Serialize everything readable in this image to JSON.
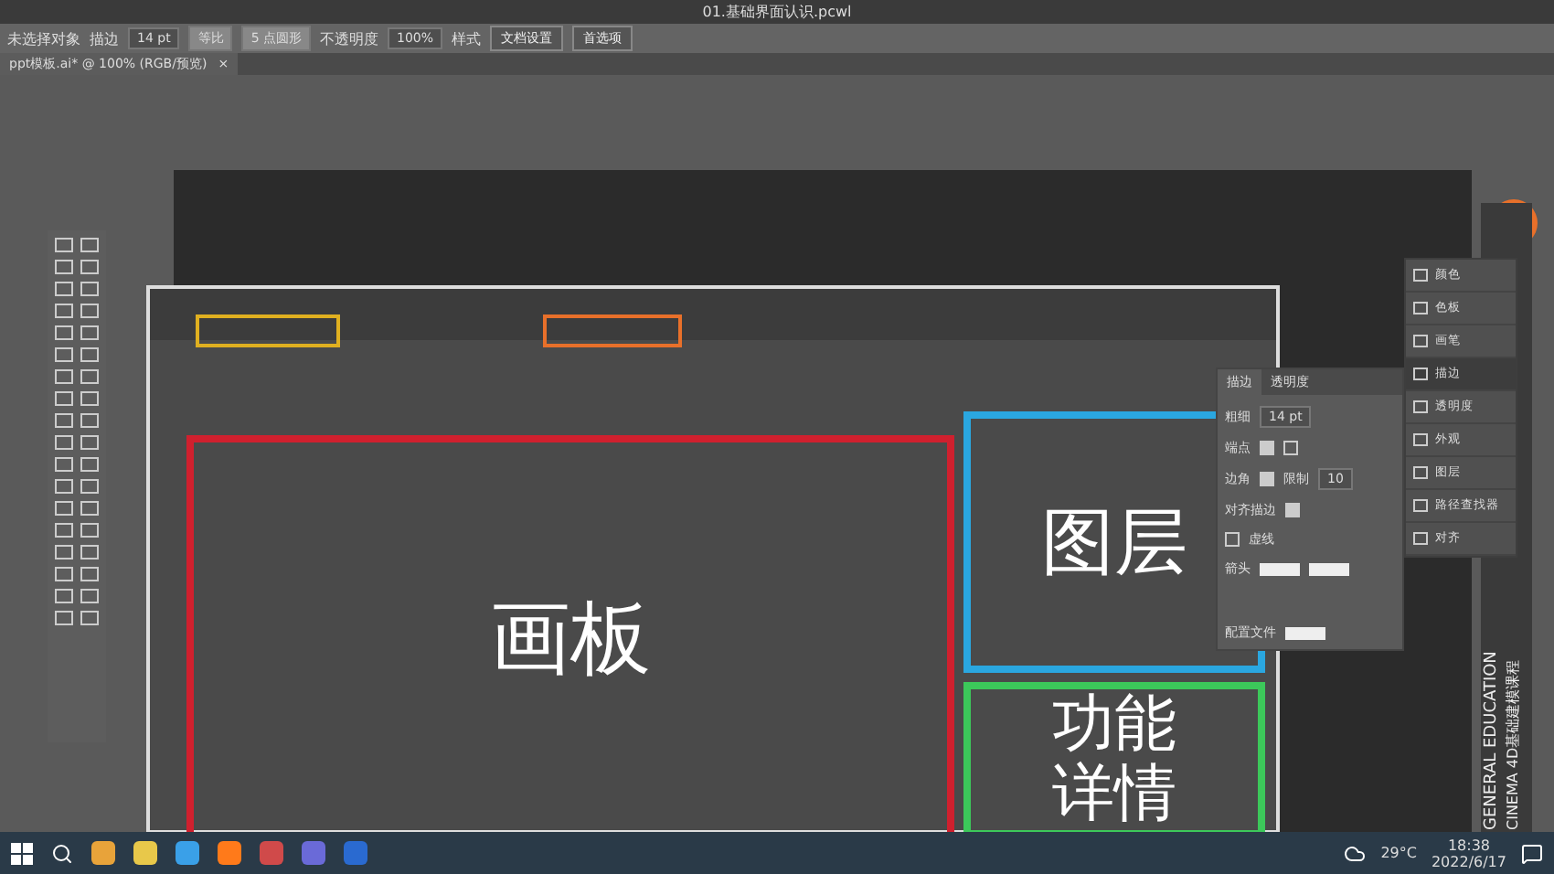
{
  "window": {
    "title": "01.基础界面认识.pcwl"
  },
  "control_bar": {
    "selection": "未选择对象",
    "stroke_label": "描边",
    "stroke_weight": "14 pt",
    "profile": "等比",
    "brush": "5 点圆形",
    "opacity_label": "不透明度",
    "opacity": "100%",
    "style_label": "样式",
    "buttons": [
      "文档设置",
      "首选项"
    ]
  },
  "document_tab": {
    "title": "ppt模板.ai* @ 100% (RGB/预览)",
    "close": "×"
  },
  "screenshot": {
    "labels": [
      {
        "text": "画板",
        "color": "#d0202e"
      },
      {
        "text": "图层",
        "color": "#2aa7e0"
      },
      {
        "text": "功能详情",
        "color": "#3cc85a"
      }
    ]
  },
  "stroke_panel": {
    "tabs": [
      {
        "label": "描边",
        "selected": true
      },
      {
        "label": "透明度",
        "selected": false
      }
    ],
    "weight_label": "粗细",
    "weight": "14 pt",
    "cap_label": "端点",
    "corner_label": "边角",
    "limit_label": "限制",
    "limit": "10",
    "align_label": "对齐描边",
    "dashed": {
      "label": "虚线",
      "checked": false
    },
    "arrow_label": "箭头",
    "profile_label": "配置文件"
  },
  "dock": {
    "items": [
      {
        "label": "颜色",
        "selected": false
      },
      {
        "label": "色板",
        "selected": false
      },
      {
        "label": "画笔",
        "selected": false
      },
      {
        "label": "描边",
        "selected": true
      },
      {
        "label": "透明度",
        "selected": false
      },
      {
        "label": "外观",
        "selected": false
      },
      {
        "label": "图层",
        "selected": false
      },
      {
        "label": "路径查找器",
        "selected": false
      },
      {
        "label": "对齐",
        "selected": false
      }
    ]
  },
  "banner": {
    "lines": [
      "GENERAL EDUCATION",
      "CINEMA 4D基础建模课程"
    ]
  },
  "taskbar": {
    "weather": "29°C",
    "time": "18:38",
    "date": "2022/6/17"
  }
}
